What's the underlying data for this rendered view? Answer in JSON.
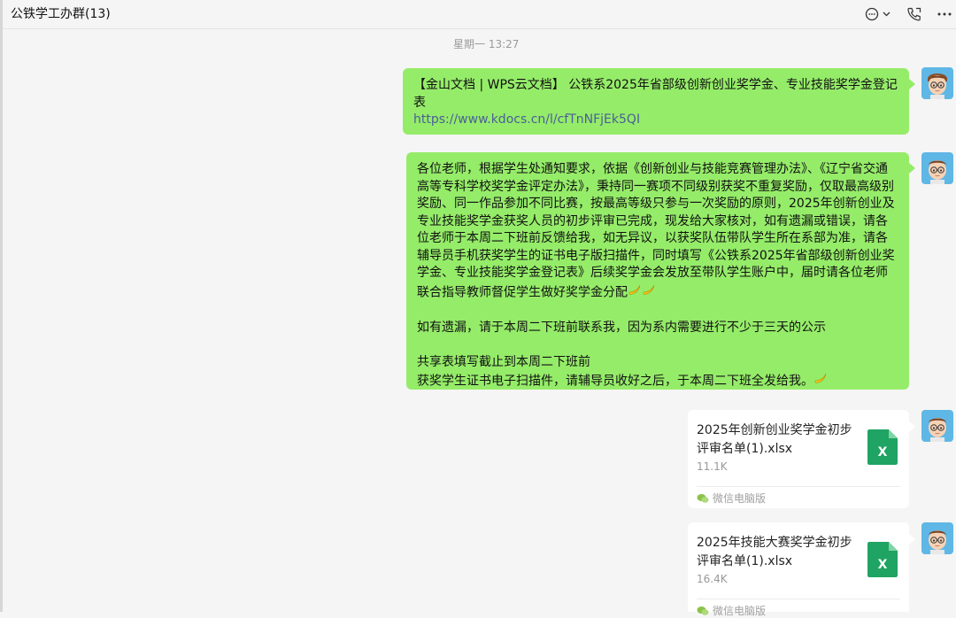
{
  "header": {
    "title": "公铁学工办群(13)"
  },
  "timestamp": "星期一 13:27",
  "messages": [
    {
      "type": "link",
      "text": "【金山文档 | WPS云文档】 公铁系2025年省部级创新创业奖学金、专业技能奖学金登记表",
      "url": "https://www.kdocs.cn/l/cfTnNFjEk5QI"
    },
    {
      "type": "text",
      "p1": "各位老师，根据学生处通知要求，依据《创新创业与技能竞赛管理办法》、《辽宁省交通高等专科学校奖学金评定办法》，秉持同一赛项不同级别获奖不重复奖励，仅取最高级别奖励、同一作品参加不同比赛，按最高等级只参与一次奖励的原则，2025年创新创业及专业技能奖学金获奖人员的初步评审已完成，现发给大家核对，如有遗漏或错误，请各位老师于本周二下班前反馈给我，如无异议，以获奖队伍带队学生所在系部为准，请各辅导员手机获奖学生的证书电子版扫描件，同时填写《公铁系2025年省部级创新创业奖学金、专业技能奖学金登记表》后续奖学金会发放至带队学生账户中，届时请各位老师联合指导教师督促学生做好奖学金分配",
      "p2": "如有遗漏，请于本周二下班前联系我，因为系内需要进行不少于三天的公示",
      "p3a": "共享表填写截止到本周二下班前",
      "p3b": "获奖学生证书电子扫描件，请辅导员收好之后，于本周二下班全发给我。"
    },
    {
      "type": "file",
      "name": "2025年创新创业奖学金初步评审名单(1).xlsx",
      "size": "11.1K",
      "source": "微信电脑版"
    },
    {
      "type": "file",
      "name": "2025年技能大赛奖学金初步评审名单(1).xlsx",
      "size": "16.4K",
      "source": "微信电脑版"
    }
  ],
  "icons": {
    "excel_letter": "X",
    "bubble_color": "#95ec69",
    "excel_color": "#1fa463"
  }
}
